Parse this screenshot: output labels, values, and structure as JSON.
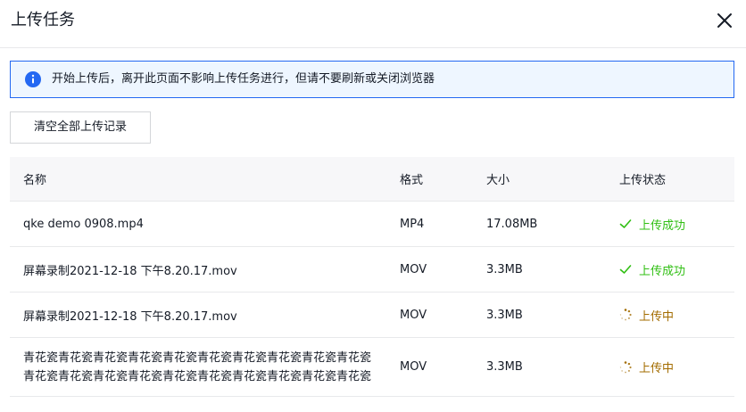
{
  "dialog": {
    "title": "上传任务",
    "notice": "开始上传后，离开此页面不影响上传任务进行，但请不要刷新或关闭浏览器",
    "clear_button": "清空全部上传记录"
  },
  "table": {
    "headers": {
      "name": "名称",
      "format": "格式",
      "size": "大小",
      "status": "上传状态"
    },
    "rows": [
      {
        "name": "qke demo 0908.mp4",
        "format": "MP4",
        "size": "17.08MB",
        "status": "上传成功",
        "state": "success"
      },
      {
        "name": "屏幕录制2021-12-18 下午8.20.17.mov",
        "format": "MOV",
        "size": "3.3MB",
        "status": "上传成功",
        "state": "success"
      },
      {
        "name": "屏幕录制2021-12-18 下午8.20.17.mov",
        "format": "MOV",
        "size": "3.3MB",
        "status": "上传中",
        "state": "uploading"
      },
      {
        "name": "青花瓷青花瓷青花瓷青花瓷青花瓷青花瓷青花瓷青花瓷青花瓷青花瓷青花瓷青花瓷青花瓷青花瓷青花瓷青花瓷青花瓷青花瓷青花瓷青花瓷",
        "format": "MOV",
        "size": "3.3MB",
        "status": "上传中",
        "state": "uploading"
      }
    ]
  },
  "colors": {
    "accent": "#2468f2",
    "success": "#30bf13",
    "uploading": "#a36c00",
    "notice_bg": "#eef6ff"
  },
  "icons": {
    "close": "close-icon",
    "info": "info-icon",
    "success": "check-icon",
    "uploading": "loading-icon"
  }
}
